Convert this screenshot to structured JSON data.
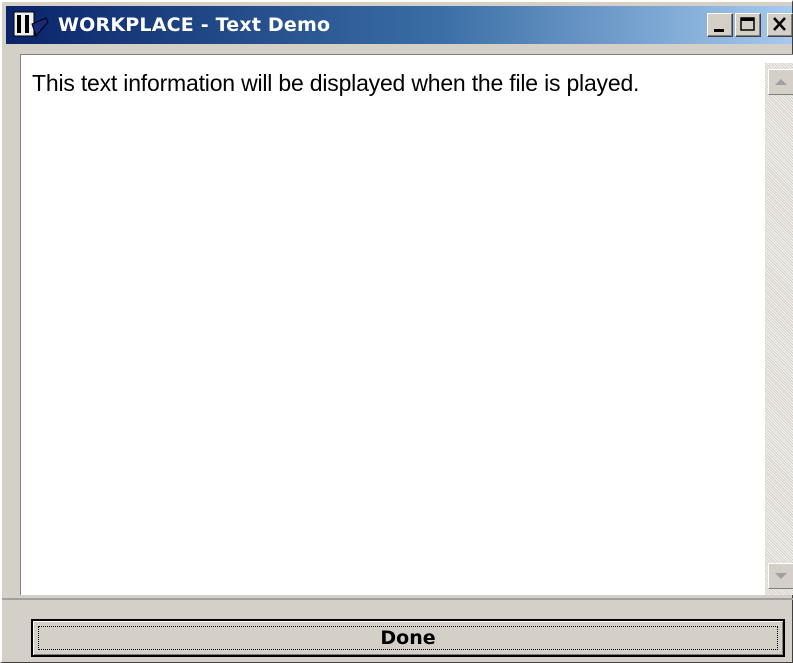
{
  "window": {
    "title": "WORKPLACE - Text Demo",
    "icon": "workplace-app-icon",
    "controls": [
      "minimize-icon",
      "maximize-icon",
      "close-icon"
    ]
  },
  "content": {
    "text": "This text information will be displayed when the file is played."
  },
  "scrollbar": {
    "up_icon": "scroll-up-arrow-icon",
    "down_icon": "scroll-down-arrow-icon"
  },
  "footer": {
    "done_label": "Done"
  },
  "colors": {
    "title_gradient_start": "#0a246a",
    "title_gradient_end": "#a6caf0",
    "window_face": "#d4d0c8",
    "text_background": "#ffffff"
  }
}
